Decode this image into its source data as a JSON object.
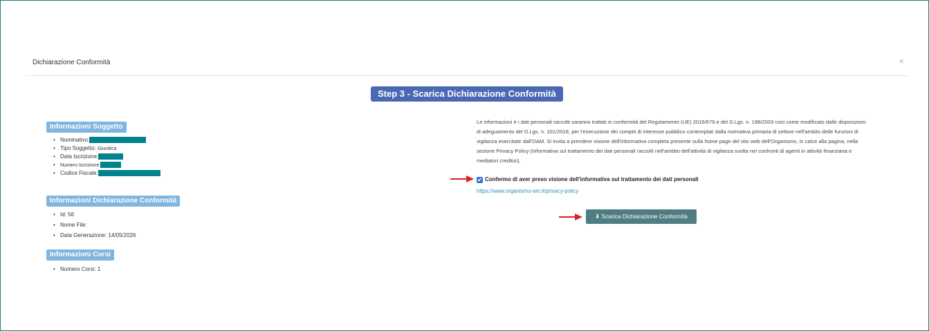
{
  "modal": {
    "title": "Dichiarazione Conformità",
    "close_label": "×",
    "step_title": "Step 3 - Scarica Dichiarazione Conformità"
  },
  "soggetto": {
    "heading": "Informazioni Soggetto",
    "nominativo_label": "Nominativo:",
    "tipo_soggetto_label": "Tipo Soggetto:",
    "tipo_soggetto_value": "Giuridica",
    "data_iscrizione_label": "Data Iscrizione:",
    "numero_iscrizione_label": "Numero Iscrizione:",
    "codice_fiscale_label": "Codice Fiscale:"
  },
  "dichiarazione": {
    "heading": "Informazioni Dichiarazione Conformità",
    "id_label": "Id:",
    "id_value": "56",
    "nome_file_label": "Nome File:",
    "data_generazione_label": "Data Generazione:",
    "data_generazione_value": "14/05/2026"
  },
  "corsi": {
    "heading": "Informazioni Corsi",
    "numero_corsi_label": "Numero Corsi:",
    "numero_corsi_value": "1"
  },
  "privacy": {
    "text": "Le informazioni e i dati personali raccolti saranno trattati in conformità del Regolamento (UE) 2016/679 e del D.Lgs. n. 196/2003 così come modificato dalle disposizioni di adeguamento del D.Lgs. n. 101/2018, per l'esecuzione dei compiti di interesse pubblico contemplati dalla normativa primaria di settore nell'ambito delle funzioni di vigilanza esercitate dall'OAM. Si invita a prendere visione dell'informativa completa presente sulla home page del sito web dell'Organismo, in calce alla pagina, nella sezione Privacy Policy (Informativa sul trattamento dei dati personali raccolti nell'ambito dell'attività di vigilanza svolta nei confronti di agenti in attività finanziaria e mediatori creditizi).",
    "confirm_label": "Confermo di aver preso visione dell'informativa sul trattamento dei dati personali",
    "checked_mark": "✔",
    "link_text": "https://www.organismo-am.it/privacy-policy"
  },
  "download": {
    "icon": "⬇",
    "label": "Scarica Dichiarazione Conformità"
  },
  "colors": {
    "frame_border": "#1f7f7c",
    "step_title_bg": "#4a68b3",
    "section_label_bg": "#7fb5de",
    "redaction": "#00838f",
    "download_bg": "#4e7d84",
    "annotation_arrow": "#e02020"
  }
}
